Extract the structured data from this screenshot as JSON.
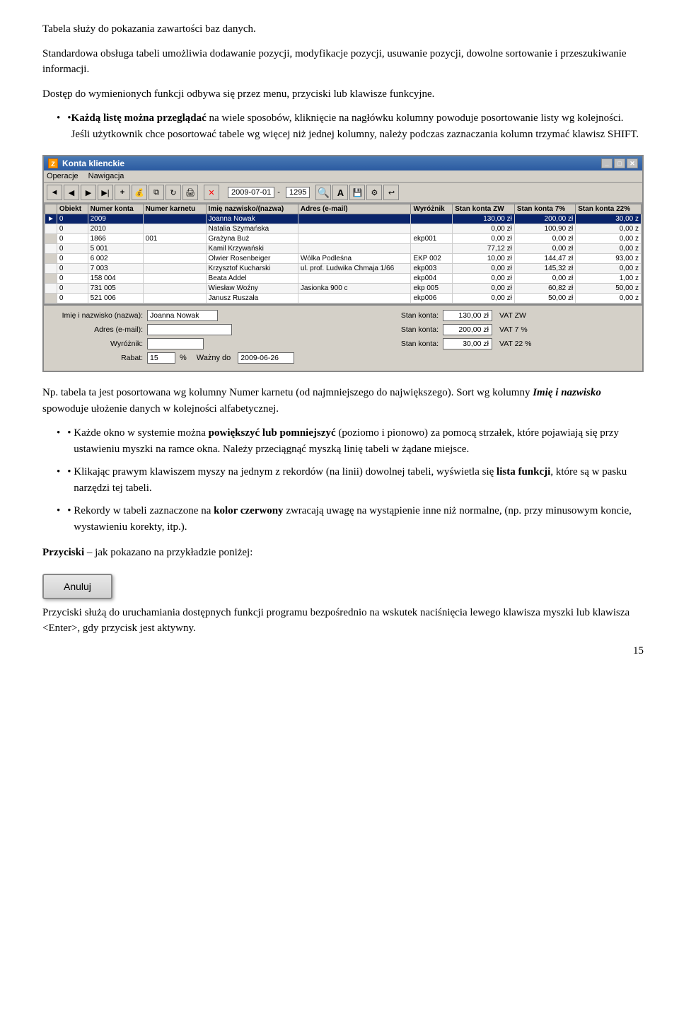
{
  "paragraphs": {
    "p1": "Tabela służy do pokazania zawartości baz danych.",
    "p2": "Standardowa obsługa tabeli umożliwia dodawanie pozycji, modyfikacje pozycji, usuwanie pozycji, dowolne sortowanie i przeszukiwanie informacji.",
    "p3": "Dostęp do wymienionych funkcji odbywa się przez menu, przyciski lub klawisze funkcyjne.",
    "bullet1_prefix": "Każdą listę można przeglądać",
    "bullet1_middle": " na wiele sposobów, kliknięcie na nagłówku kolumny powoduje posortowanie listy wg kolejności.",
    "bullet1_shift": "Jeśli użytkownik chce posortować tabele wg więcej niż jednej kolumny, należy podczas zaznaczania kolumn trzymać klawisz SHIFT.",
    "np_text": "Np. tabela ta jest posortowana wg kolumny Numer karnetu (od najmniejszego do największego).",
    "sort_text_prefix": " Sort wg kolumny ",
    "sort_italic": "Imię i nazwisko",
    "sort_text_suffix": " spowoduje ułożenie danych w kolejności alfabetycznej.",
    "bullet2_prefix": "Każde okno w systemie można ",
    "bullet2_bold": "powiększyć lub pomniejszyć",
    "bullet2_suffix": " (poziomo i pionowo) za pomocą strzałek, które pojawiają się przy ustawieniu myszki na ramce okna. Należy przeciągnąć myszką linię tabeli w żądane miejsce.",
    "bullet3_prefix": "Klikając prawym klawiszem myszy na jednym z rekordów (na linii) dowolnej tabeli, wyświetla się ",
    "bullet3_bold": "lista funkcji",
    "bullet3_suffix": ", które są w pasku narzędzi tej tabeli.",
    "bullet4_prefix": "Rekordy w tabeli zaznaczone na ",
    "bullet4_bold": "kolor czerwony",
    "bullet4_suffix": " zwracają uwagę na wystąpienie inne niż normalne, (np.  przy minusowym koncie, wystawieniu korekty, itp.).",
    "przyciski_bold": "Przyciski",
    "przyciski_suffix": " – jak pokazano na przykładzie poniżej:",
    "przyciski_desc": "Przyciski służą do uruchamiania dostępnych funkcji programu bezpośrednio na wskutek naciśnięcia lewego klawisza myszki lub klawisza <Enter>, gdy przycisk jest aktywny.",
    "anuluj_label": "Anuluj",
    "page_number": "15"
  },
  "window": {
    "title": "Konta klienckie",
    "menu_items": [
      "Operacje",
      "Nawigacja"
    ],
    "toolbar": {
      "date": "2009-07-01",
      "number": "1295"
    },
    "table": {
      "columns": [
        "Obiekt",
        "Numer konta",
        "Numer karnetu",
        "Imię nazwisko/(nazwa)",
        "Adres (e-mail)",
        "Wyróżnik",
        "Stan konta ZW",
        "Stan konta 7%",
        "Stan konta 22%"
      ],
      "rows": [
        {
          "indicator": "►",
          "obiekt": "0",
          "numer_konta": "2009",
          "numer_karnetu": "",
          "imie": "Joanna Nowak",
          "adres": "",
          "wyroznik": "",
          "stan_zw": "130,00 zł",
          "stan_7": "200,00 zł",
          "stan_22": "30,00 z"
        },
        {
          "indicator": "",
          "obiekt": "0",
          "numer_konta": "2010",
          "numer_karnetu": "",
          "imie": "Natalia Szymańska",
          "adres": "",
          "wyroznik": "",
          "stan_zw": "0,00 zł",
          "stan_7": "100,90 zł",
          "stan_22": "0,00 z"
        },
        {
          "indicator": "",
          "obiekt": "0",
          "numer_konta": "1866",
          "numer_karnetu": "001",
          "imie": "Grażyna Buż",
          "adres": "",
          "wyroznik": "ekp001",
          "stan_zw": "0,00 zł",
          "stan_7": "0,00 zł",
          "stan_22": "0,00 z"
        },
        {
          "indicator": "",
          "obiekt": "0",
          "numer_konta": "5 001",
          "numer_karnetu": "",
          "imie": "Kamil Krzywański",
          "adres": "",
          "wyroznik": "",
          "stan_zw": "77,12 zł",
          "stan_7": "0,00 zł",
          "stan_22": "0,00 z"
        },
        {
          "indicator": "",
          "obiekt": "0",
          "numer_konta": "6 002",
          "numer_karnetu": "",
          "imie": "Olwier Rosenbeiger",
          "adres": "Wólka Podleśna",
          "wyroznik": "EKP 002",
          "stan_zw": "10,00 zł",
          "stan_7": "144,47 zł",
          "stan_22": "93,00 z"
        },
        {
          "indicator": "",
          "obiekt": "0",
          "numer_konta": "7 003",
          "numer_karnetu": "",
          "imie": "Krzysztof Kucharski",
          "adres": "ul. prof. Ludwika Chmaja 1/66",
          "wyroznik": "ekp003",
          "stan_zw": "0,00 zł",
          "stan_7": "145,32 zł",
          "stan_22": "0,00 z"
        },
        {
          "indicator": "",
          "obiekt": "0",
          "numer_konta": "158 004",
          "numer_karnetu": "",
          "imie": "Beata Addel",
          "adres": "",
          "wyroznik": "ekp004",
          "stan_zw": "0,00 zł",
          "stan_7": "0,00 zł",
          "stan_22": "1,00 z"
        },
        {
          "indicator": "",
          "obiekt": "0",
          "numer_konta": "731 005",
          "numer_karnetu": "",
          "imie": "Wiesław Woźny",
          "adres": "Jasionka 900 c",
          "wyroznik": "ekp 005",
          "stan_zw": "0,00 zł",
          "stan_7": "60,82 zł",
          "stan_22": "50,00 z"
        },
        {
          "indicator": "",
          "obiekt": "0",
          "numer_konta": "521 006",
          "numer_karnetu": "",
          "imie": "Janusz Ruszała",
          "adres": "",
          "wyroznik": "ekp006",
          "stan_zw": "0,00 zł",
          "stan_7": "50,00 zł",
          "stan_22": "0,00 z"
        }
      ]
    },
    "detail": {
      "imie_label": "Imię i nazwisko (nazwa):",
      "imie_value": "Joanna Nowak",
      "adres_label": "Adres (e-mail):",
      "adres_value": "",
      "wyroznik_label": "Wyróżnik:",
      "wyroznik_value": "",
      "rabat_label": "Rabat:",
      "rabat_value": "15",
      "rabat_pct": "%",
      "wazny_label": "Ważny do",
      "wazny_value": "2009-06-26",
      "stan_konta_label1": "Stan konta:",
      "stan_konta_value1": "130,00 zł",
      "vat_label1": "VAT ZW",
      "stan_konta_label2": "Stan konta:",
      "stan_konta_value2": "200,00 zł",
      "vat_label2": "VAT 7 %",
      "stan_konta_label3": "Stan konta:",
      "stan_konta_value3": "30,00 zł",
      "vat_label3": "VAT 22 %"
    }
  }
}
